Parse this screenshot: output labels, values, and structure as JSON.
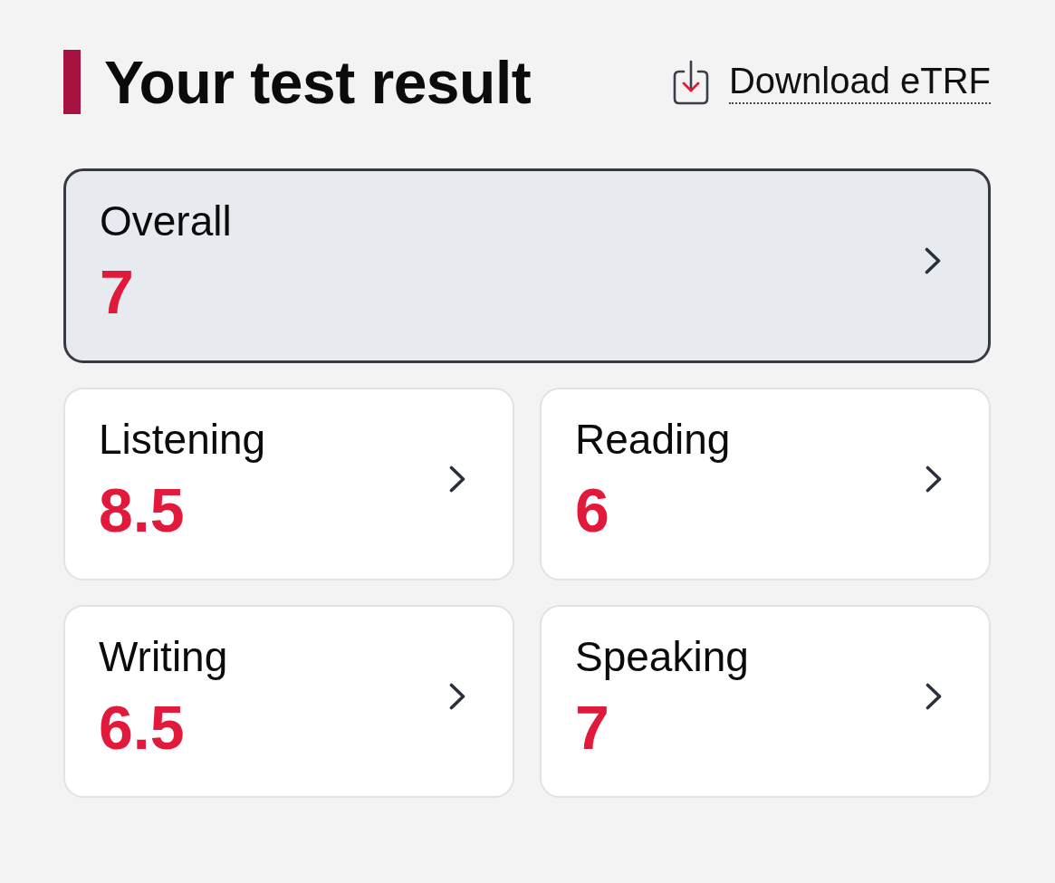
{
  "header": {
    "title": "Your test result",
    "download_link": "Download eTRF"
  },
  "overall": {
    "label": "Overall",
    "score": "7",
    "selected": true
  },
  "sections": [
    {
      "label": "Listening",
      "score": "8.5",
      "selected": false
    },
    {
      "label": "Reading",
      "score": "6",
      "selected": false
    },
    {
      "label": "Writing",
      "score": "6.5",
      "selected": false
    },
    {
      "label": "Speaking",
      "score": "7",
      "selected": false
    }
  ]
}
